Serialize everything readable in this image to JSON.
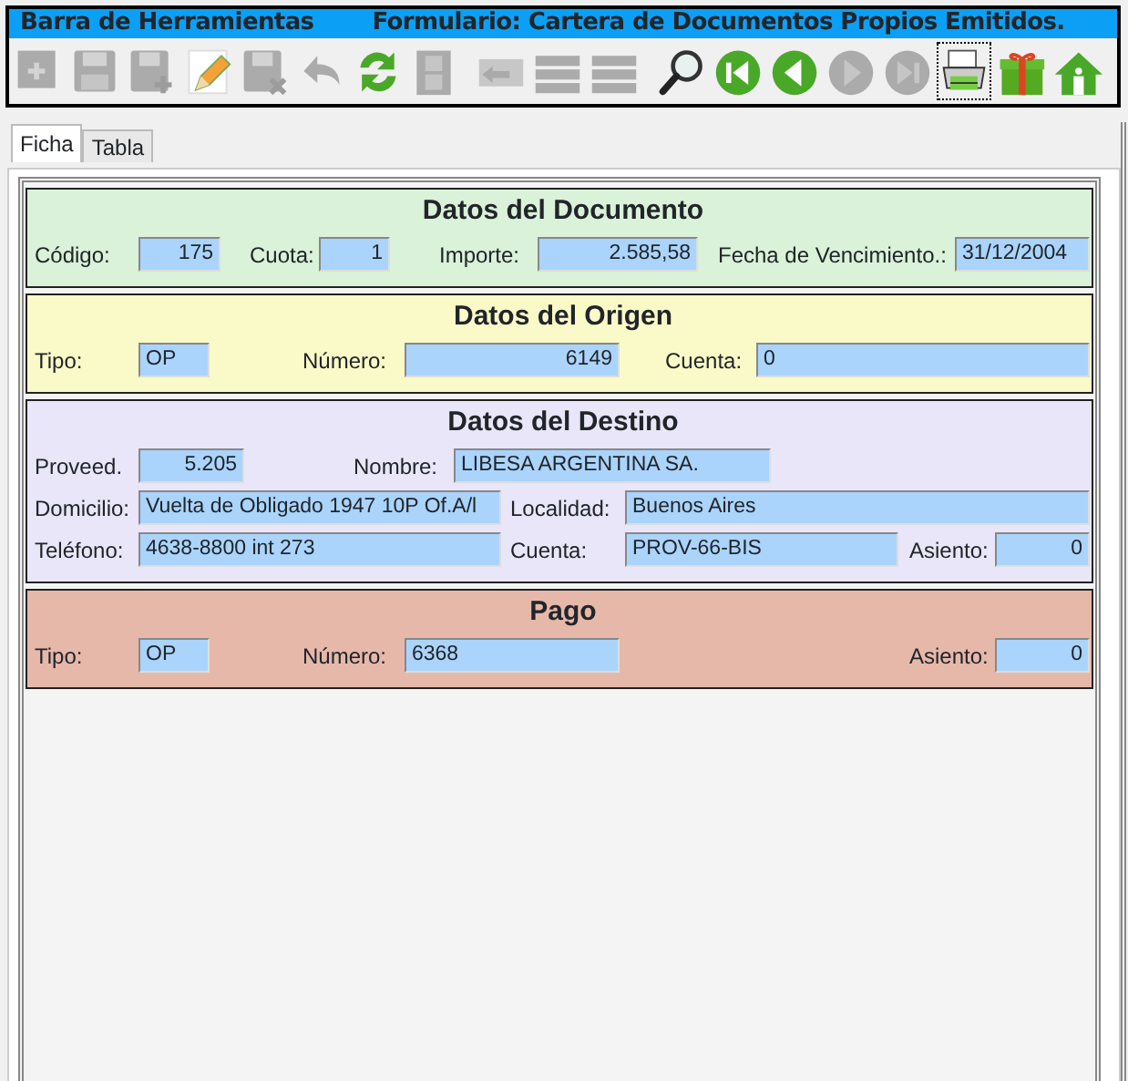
{
  "toolbar": {
    "title": "Barra de Herramientas",
    "form_title": "Formulario: Cartera de Documentos Propios Emitidos.",
    "buttons": [
      {
        "kind": "add",
        "disabled": true
      },
      {
        "kind": "save",
        "disabled": true
      },
      {
        "kind": "save-as",
        "disabled": true
      },
      {
        "kind": "edit",
        "disabled": false
      },
      {
        "kind": "save-delete",
        "disabled": true
      },
      {
        "kind": "undo",
        "disabled": true
      },
      {
        "kind": "refresh",
        "disabled": false
      },
      {
        "kind": "film",
        "disabled": true
      },
      {
        "kind": "back",
        "disabled": true
      },
      {
        "kind": "list",
        "disabled": true
      },
      {
        "kind": "list",
        "disabled": true
      },
      {
        "kind": "search",
        "disabled": false
      },
      {
        "kind": "first",
        "disabled": false
      },
      {
        "kind": "prev",
        "disabled": false
      },
      {
        "kind": "next",
        "disabled": true
      },
      {
        "kind": "last",
        "disabled": true
      },
      {
        "kind": "print",
        "disabled": false,
        "focused": true
      },
      {
        "kind": "gift",
        "disabled": false
      },
      {
        "kind": "home",
        "disabled": false
      }
    ]
  },
  "tabs": [
    {
      "label": "Ficha",
      "selected": true
    },
    {
      "label": "Tabla",
      "selected": false
    }
  ],
  "sections": [
    {
      "title": "Datos del Documento",
      "color": "#d9f2d9",
      "rows": [
        [
          {
            "label": "Código:",
            "value": "175",
            "numeric": true
          },
          {
            "label": "Cuota:",
            "value": "1",
            "numeric": true
          },
          {
            "label": "Importe:",
            "value": "2.585,58",
            "numeric": true
          },
          {
            "label": "Fecha de Vencimiento.:",
            "value": "31/12/2004",
            "numeric": false
          }
        ]
      ]
    },
    {
      "title": "Datos del Origen",
      "color": "#fafac8",
      "rows": [
        [
          {
            "label": "Tipo:",
            "value": "OP",
            "numeric": false
          },
          {
            "label": "Número:",
            "value": "6149",
            "numeric": true
          },
          {
            "label": "Cuenta:",
            "value": "0",
            "numeric": false
          }
        ]
      ]
    },
    {
      "title": "Datos del Destino",
      "color": "#e8e6f8",
      "rows": [
        [
          {
            "label": "Proveed.",
            "value": "5.205",
            "numeric": true
          },
          {
            "label": "Nombre:",
            "value": "LIBESA ARGENTINA SA.",
            "numeric": false
          }
        ],
        [
          {
            "label": "Domicilio:",
            "value": "Vuelta de Obligado 1947 10P Of.A/l",
            "numeric": false
          },
          {
            "label": "Localidad:",
            "value": "Buenos Aires",
            "numeric": false
          }
        ],
        [
          {
            "label": "Teléfono:",
            "value": "4638-8800 int 273",
            "numeric": false
          },
          {
            "label": "Cuenta:",
            "value": "PROV-66-BIS",
            "numeric": false
          },
          {
            "label": "Asiento:",
            "value": "0",
            "numeric": true
          }
        ]
      ]
    },
    {
      "title": "Pago",
      "color": "#e6b8aa",
      "rows": [
        [
          {
            "label": "Tipo:",
            "value": "OP",
            "numeric": false
          },
          {
            "label": "Número:",
            "value": "6368",
            "numeric": false
          },
          {
            "label": "Asiento:",
            "value": "0",
            "numeric": true
          }
        ]
      ]
    }
  ]
}
